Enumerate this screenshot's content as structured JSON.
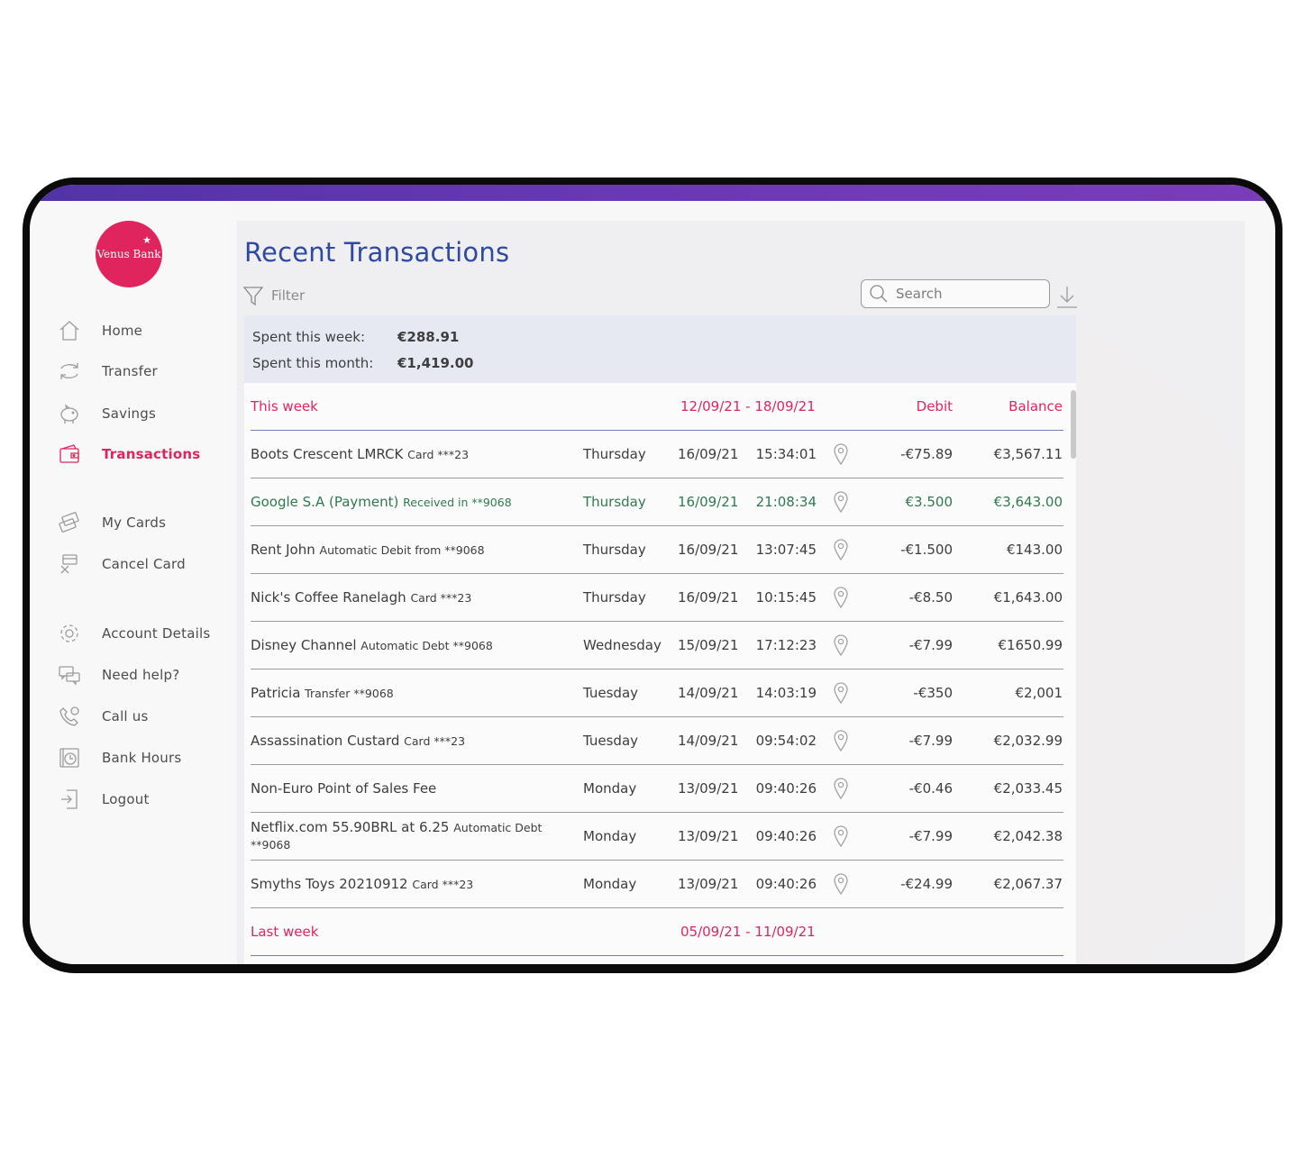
{
  "bank": {
    "name": "Venus Bank",
    "brand_color": "#e0255e"
  },
  "sidebar": {
    "items": [
      {
        "label": "Home",
        "icon": "home-icon"
      },
      {
        "label": "Transfer",
        "icon": "transfer-icon"
      },
      {
        "label": "Savings",
        "icon": "piggy-bank-icon"
      },
      {
        "label": "Transactions",
        "icon": "wallet-icon",
        "active": true
      },
      {
        "label": "My Cards",
        "icon": "cards-icon"
      },
      {
        "label": "Cancel Card",
        "icon": "cancel-card-icon"
      },
      {
        "label": "Account Details",
        "icon": "gear-icon"
      },
      {
        "label": "Need help?",
        "icon": "chat-icon"
      },
      {
        "label": "Call us",
        "icon": "phone-icon"
      },
      {
        "label": "Bank Hours",
        "icon": "clock-icon"
      },
      {
        "label": "Logout",
        "icon": "logout-icon"
      }
    ]
  },
  "page": {
    "title": "Recent Transactions"
  },
  "toolbar": {
    "filter_label": "Filter",
    "search_placeholder": "Search"
  },
  "summary": {
    "week_label": "Spent this week:",
    "week_value": "€288.91",
    "month_label": "Spent this month:",
    "month_value": "€1,419.00"
  },
  "table": {
    "this_week": {
      "label": "This week",
      "range": "12/09/21 - 18/09/21",
      "debit_header": "Debit",
      "balance_header": "Balance"
    },
    "rows": [
      {
        "merchant": "Boots Crescent LMRCK",
        "detail": "Card ***23",
        "day": "Thursday",
        "date": "16/09/21",
        "time": "15:34:01",
        "amount": "-€75.89",
        "balance": "€3,567.11"
      },
      {
        "merchant": "Google S.A (Payment)",
        "detail": "Received in **9068",
        "day": "Thursday",
        "date": "16/09/21",
        "time": "21:08:34",
        "amount": "€3.500",
        "balance": "€3,643.00",
        "credit": true
      },
      {
        "merchant": "Rent John",
        "detail": "Automatic Debit from **9068",
        "day": "Thursday",
        "date": "16/09/21",
        "time": "13:07:45",
        "amount": "-€1.500",
        "balance": "€143.00"
      },
      {
        "merchant": "Nick's Coffee Ranelagh",
        "detail": "Card ***23",
        "day": "Thursday",
        "date": "16/09/21",
        "time": "10:15:45",
        "amount": "-€8.50",
        "balance": "€1,643.00"
      },
      {
        "merchant": "Disney Channel",
        "detail": "Automatic Debt **9068",
        "day": "Wednesday",
        "date": "15/09/21",
        "time": "17:12:23",
        "amount": "-€7.99",
        "balance": "€1650.99"
      },
      {
        "merchant": "Patricia",
        "detail": "Transfer **9068",
        "day": "Tuesday",
        "date": "14/09/21",
        "time": "14:03:19",
        "amount": "-€350",
        "balance": "€2,001"
      },
      {
        "merchant": "Assassination Custard",
        "detail": "Card ***23",
        "day": "Tuesday",
        "date": "14/09/21",
        "time": "09:54:02",
        "amount": "-€7.99",
        "balance": "€2,032.99"
      },
      {
        "merchant": "Non-Euro Point of Sales Fee",
        "detail": "",
        "day": "Monday",
        "date": "13/09/21",
        "time": "09:40:26",
        "amount": "-€0.46",
        "balance": "€2,033.45"
      },
      {
        "merchant": "Netflix.com 55.90BRL at 6.25",
        "detail": "Automatic Debt **9068",
        "day": "Monday",
        "date": "13/09/21",
        "time": "09:40:26",
        "amount": "-€7.99",
        "balance": "€2,042.38"
      },
      {
        "merchant": "Smyths Toys 20210912",
        "detail": "Card ***23",
        "day": "Monday",
        "date": "13/09/21",
        "time": "09:40:26",
        "amount": "-€24.99",
        "balance": "€2,067.37"
      }
    ],
    "last_week": {
      "label": "Last week",
      "range": "05/09/21 - 11/09/21"
    }
  }
}
